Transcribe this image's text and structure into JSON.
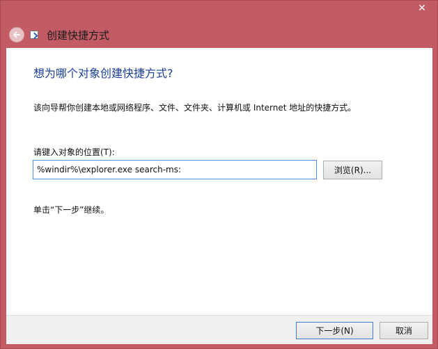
{
  "window": {
    "title": "创建快捷方式",
    "close_symbol": "✕",
    "back_icon": "back-arrow-icon",
    "app_icon": "shortcut-icon"
  },
  "main": {
    "heading": "想为哪个对象创建快捷方式?",
    "description": "该向导帮你创建本地或网络程序、文件、文件夹、计算机或 Internet 地址的快捷方式。",
    "location_label": "请键入对象的位置(T):",
    "location_value": "%windir%\\explorer.exe search-ms:",
    "browse_label": "浏览(R)...",
    "hint": "单击“下一步”继续。"
  },
  "footer": {
    "next_label": "下一步(N)",
    "cancel_label": "取消"
  },
  "colors": {
    "frame": "#c35b64",
    "heading": "#1b3f9a",
    "focus_border": "#4a8fd8"
  }
}
